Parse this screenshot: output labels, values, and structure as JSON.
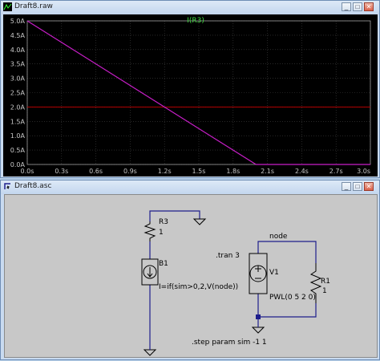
{
  "plot_window": {
    "title": "Draft8.raw",
    "trace_label": "I(R3)",
    "buttons": {
      "minimize": "_",
      "maximize": "□",
      "close": "✕"
    }
  },
  "schematic_window": {
    "title": "Draft8.asc",
    "buttons": {
      "minimize": "_",
      "maximize": "□",
      "close": "✕"
    }
  },
  "chart_data": {
    "type": "line",
    "title": "I(R3)",
    "xlabel": "",
    "ylabel": "",
    "xlim": [
      0,
      3.0
    ],
    "ylim": [
      0,
      5.0
    ],
    "x_ticks": [
      "0.0s",
      "0.3s",
      "0.6s",
      "0.9s",
      "1.2s",
      "1.5s",
      "1.8s",
      "2.1s",
      "2.4s",
      "2.7s",
      "3.0s"
    ],
    "y_ticks": [
      "0.0A",
      "0.5A",
      "1.0A",
      "1.5A",
      "2.0A",
      "2.5A",
      "3.0A",
      "3.5A",
      "4.0A",
      "4.5A",
      "5.0A"
    ],
    "grid": true,
    "background": "#000000",
    "series": [
      {
        "name": "I(R3)",
        "color": "#c81ec8",
        "x": [
          0,
          2.0,
          2.0,
          3.0
        ],
        "y": [
          5.0,
          0,
          0,
          0
        ]
      }
    ],
    "reference_lines": [
      {
        "axis": "y",
        "value": 2.0,
        "color": "#b40000"
      }
    ]
  },
  "schematic": {
    "R3": {
      "name": "R3",
      "value": "1"
    },
    "B1": {
      "name": "B1",
      "expr": "I=if(sim>0,2,V(node))"
    },
    "V1": {
      "name": "V1",
      "value": "PWL(0 5 2 0)"
    },
    "R1": {
      "name": "R1",
      "value": "1"
    },
    "node_label": "node",
    "directives": {
      "tran": ".tran 3",
      "step": ".step param sim -1 1"
    }
  },
  "colors": {
    "wire": "#1e1e8c",
    "component": "#000000",
    "label": "#000000"
  }
}
